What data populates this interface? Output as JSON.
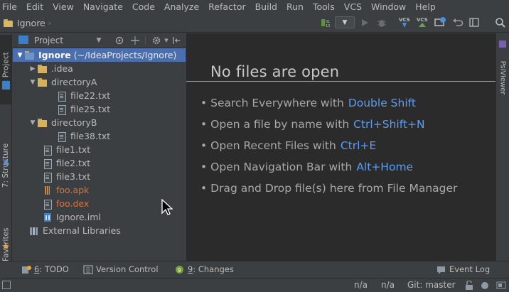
{
  "menu": [
    "File",
    "Edit",
    "View",
    "Navigate",
    "Code",
    "Analyze",
    "Refactor",
    "Build",
    "Run",
    "Tools",
    "VCS",
    "Window",
    "Help"
  ],
  "navbar": {
    "project_name": "Ignore",
    "vcs_update_label": "VCS",
    "vcs_commit_label": "VCS"
  },
  "left_tabs": {
    "project": "1: Project",
    "structure": "7: Structure",
    "favorites": "2: Favorites"
  },
  "right_tabs": {
    "psiviewer": "PsiViewer"
  },
  "project_panel": {
    "title": "Project",
    "tree": [
      {
        "label": "Ignore",
        "path": "(~/IdeaProjects/Ignore)",
        "icon": "module-folder-icon",
        "expanded": true,
        "selected": true
      },
      {
        "label": ".idea",
        "icon": "folder-icon",
        "expanded": false
      },
      {
        "label": "directoryA",
        "icon": "folder-icon",
        "expanded": true
      },
      {
        "label": "file22.txt",
        "icon": "text-file-icon"
      },
      {
        "label": "file25.txt",
        "icon": "text-file-icon"
      },
      {
        "label": "directoryB",
        "icon": "folder-icon",
        "expanded": true
      },
      {
        "label": "file38.txt",
        "icon": "text-file-icon"
      },
      {
        "label": "file1.txt",
        "icon": "text-file-icon"
      },
      {
        "label": "file2.txt",
        "icon": "text-file-icon"
      },
      {
        "label": "file3.txt",
        "icon": "text-file-icon"
      },
      {
        "label": "foo.apk",
        "icon": "archive-icon",
        "color": "#d2744a"
      },
      {
        "label": "foo.dex",
        "icon": "text-file-icon",
        "color": "#d2744a"
      },
      {
        "label": "Ignore.iml",
        "icon": "module-file-icon"
      },
      {
        "label": "External Libraries",
        "icon": "libraries-icon"
      }
    ]
  },
  "editor": {
    "empty_title": "No files are open",
    "hints": [
      {
        "text": "Search Everywhere with",
        "shortcut": "Double Shift"
      },
      {
        "text": "Open a file by name with",
        "shortcut": "Ctrl+Shift+N"
      },
      {
        "text": "Open Recent Files with",
        "shortcut": "Ctrl+E"
      },
      {
        "text": "Open Navigation Bar with",
        "shortcut": "Alt+Home"
      },
      {
        "text": "Drag and Drop file(s) here from File Manager",
        "shortcut": ""
      }
    ]
  },
  "bottom_tabs": {
    "todo_num": "6",
    "todo": ": TODO",
    "version_control": "Version Control",
    "changes_num": "9",
    "changes": ": Changes",
    "event_log": "Event Log"
  },
  "status_bar": {
    "position": "n/a",
    "encoding": "n/a",
    "git_branch": "Git: master"
  },
  "colors": {
    "selection": "#4b6eaf",
    "shortcut": "#589df6",
    "ignored_file": "#d2744a",
    "editor_bg": "#2b2b2b",
    "panel_bg": "#3c3f41"
  }
}
